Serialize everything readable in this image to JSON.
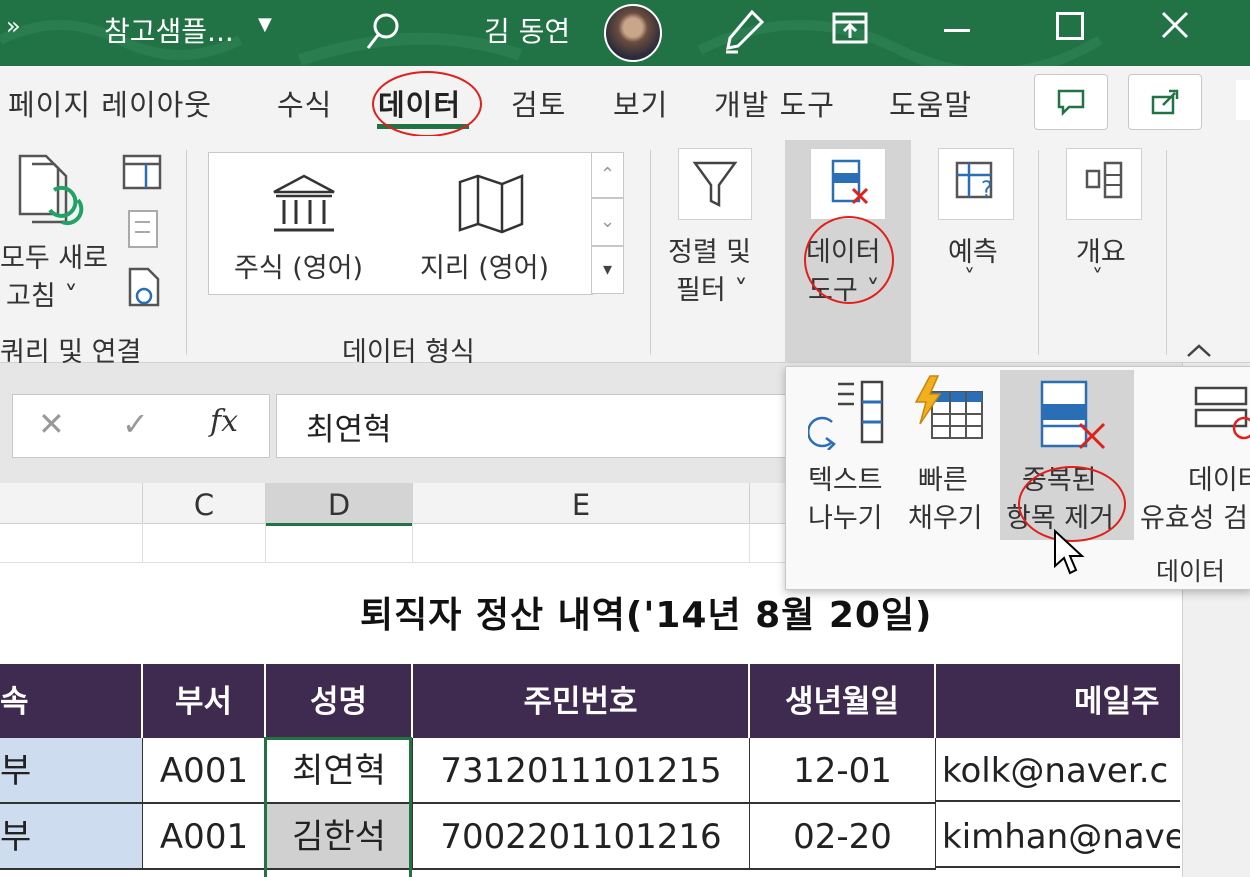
{
  "titlebar": {
    "filename": "참고샘플...",
    "user": "김 동연"
  },
  "tabs": [
    {
      "label": "페이지 레이아웃"
    },
    {
      "label": "수식"
    },
    {
      "label": "데이터",
      "active": true
    },
    {
      "label": "검토"
    },
    {
      "label": "보기"
    },
    {
      "label": "개발 도구"
    },
    {
      "label": "도움말"
    }
  ],
  "ribbon": {
    "query": {
      "refresh_line1": "모두 새로",
      "refresh_line2": "고침 ˅",
      "group_label": "쿼리 및 연결"
    },
    "datatypes": {
      "stocks": "주식 (영어)",
      "geography": "지리 (영어)",
      "group_label": "데이터 형식"
    },
    "sort_filter": {
      "line1": "정렬 및",
      "line2": "필터 ˅"
    },
    "data_tools": {
      "line1": "데이터",
      "line2": "도구 ˅"
    },
    "forecast": {
      "label": "예측",
      "chevron": "˅"
    },
    "outline": {
      "label": "개요",
      "chevron": "˅"
    }
  },
  "formula_bar": {
    "cancel": "✕",
    "enter": "✓",
    "fx": "fx",
    "value": "최연혁"
  },
  "columns": [
    "C",
    "D",
    "E"
  ],
  "dropdown": {
    "text_to_columns": [
      "텍스트",
      "나누기"
    ],
    "flash_fill": [
      "빠른",
      "채우기"
    ],
    "remove_duplicates": [
      "중복된",
      "항목 제거"
    ],
    "data_validation": [
      "데이터",
      "유효성 검"
    ],
    "group_label": "데이터"
  },
  "sheet": {
    "title": "퇴직자 정산 내역('14년 8월 20일)",
    "headers": [
      "속",
      "부서",
      "성명",
      "주민번호",
      "생년월일",
      "메일주"
    ],
    "rows": [
      [
        "부",
        "A001",
        "최연혁",
        "7312011101215",
        "12-01",
        "kolk@naver.c"
      ],
      [
        "부",
        "A001",
        "김한석",
        "7002201101216",
        "02-20",
        "kimhan@nave"
      ]
    ]
  },
  "colors": {
    "excel_green": "#217346",
    "header_purple": "#3e2b4f",
    "annotation_red": "#e0201a",
    "light_blue_cell": "#cddcef",
    "selected_gray": "#d0d0d0"
  }
}
